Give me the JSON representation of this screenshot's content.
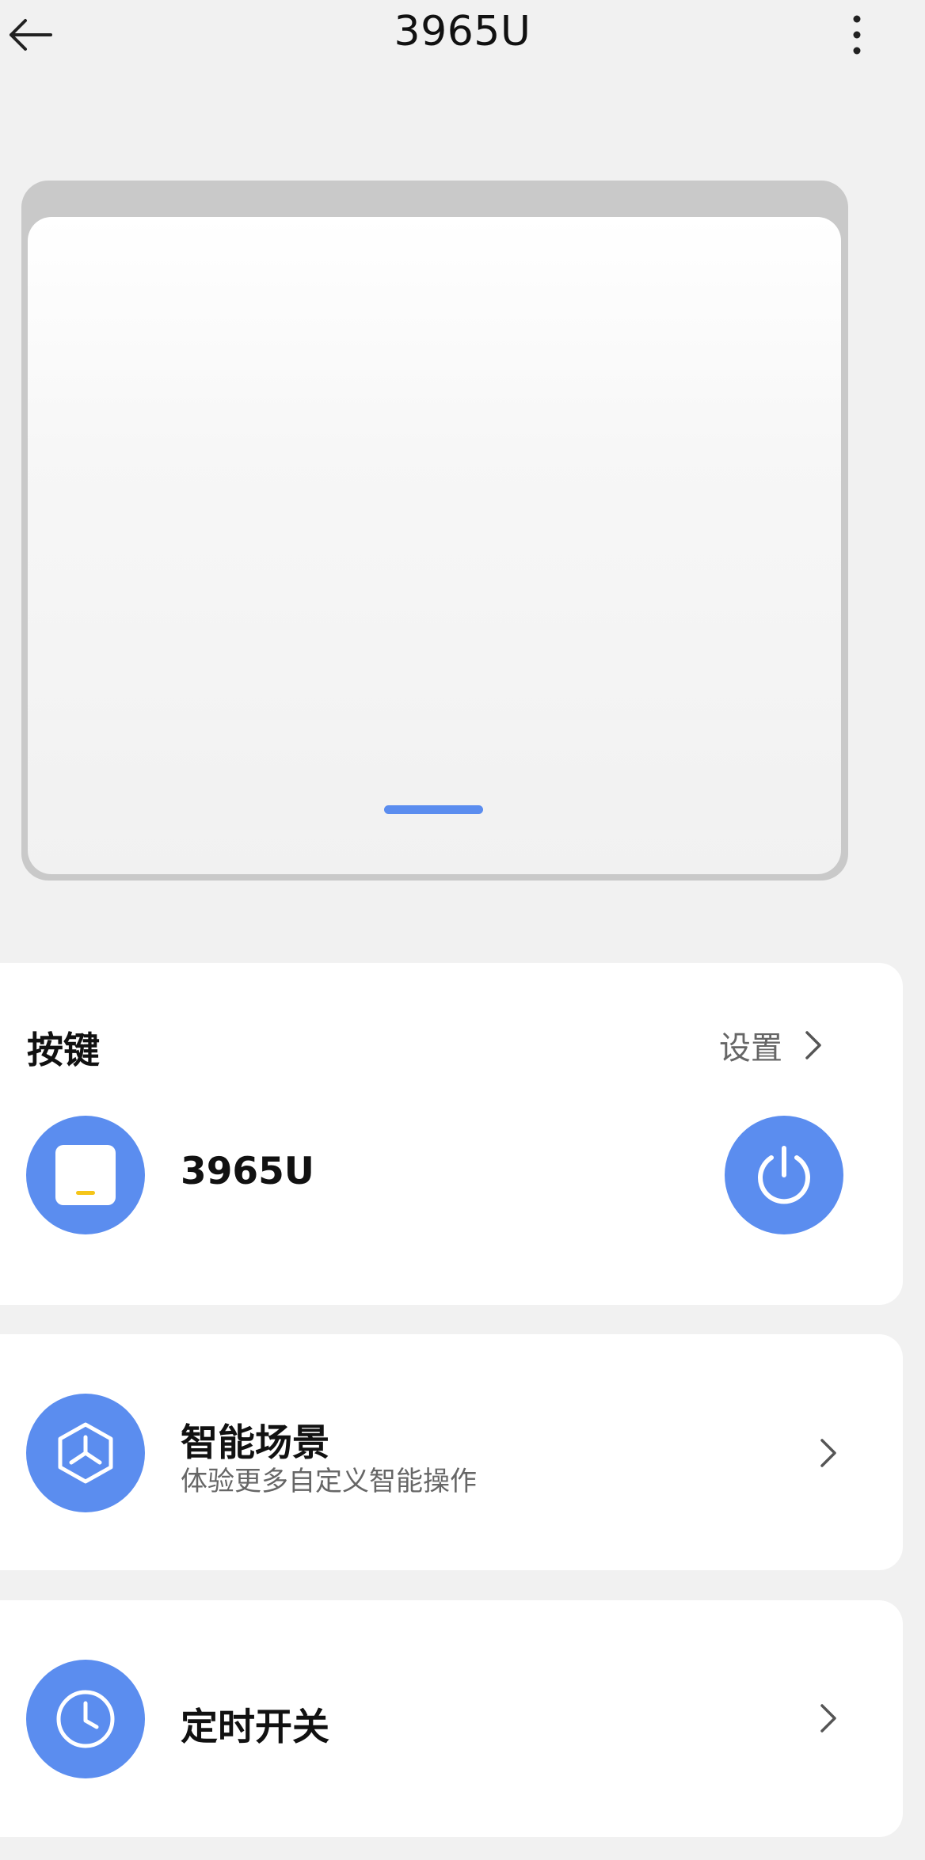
{
  "header": {
    "title": "3965U",
    "back_icon": "arrow-left-icon",
    "more_icon": "more-vertical-icon"
  },
  "panel": {
    "indicator_color": "#5b8def"
  },
  "keys_section": {
    "title": "按键",
    "settings_label": "设置",
    "device_name": "3965U",
    "device_icon": "switch-panel-icon",
    "power_icon": "power-icon"
  },
  "scene_card": {
    "title": "智能场景",
    "subtitle": "体验更多自定义智能操作",
    "icon": "smart-scene-icon"
  },
  "timer_card": {
    "title": "定时开关",
    "icon": "clock-icon"
  },
  "colors": {
    "accent": "#5b8def",
    "background": "#f1f1f1",
    "card": "#ffffff",
    "indicator_dot": "#f5c518"
  }
}
